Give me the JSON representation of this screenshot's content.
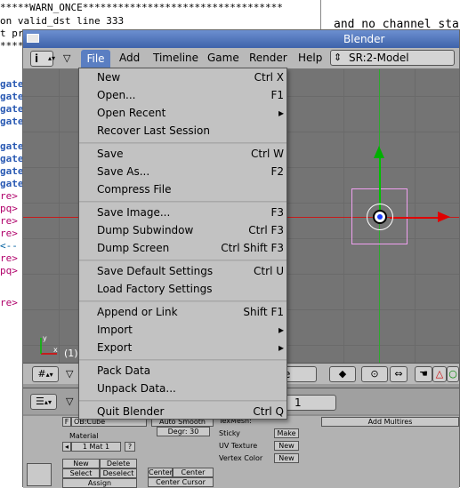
{
  "terminal": {
    "lines": [
      "*****WARN_ONCE**********************************",
      "on valid_dst line 333",
      "t pr",
      "****"
    ],
    "left_fragments": [
      {
        "text": "gate",
        "cls": "gate"
      },
      {
        "text": "gate",
        "cls": "gate"
      },
      {
        "text": "gate",
        "cls": "gate"
      },
      {
        "text": "gate",
        "cls": "gate"
      },
      {
        "text": "gate",
        "cls": "gate"
      },
      {
        "text": "gate",
        "cls": "gate"
      },
      {
        "text": "gate",
        "cls": "gate"
      },
      {
        "text": "gate",
        "cls": "gate"
      },
      {
        "text": "re>",
        "cls": "tag"
      },
      {
        "text": "pq>",
        "cls": "tag"
      },
      {
        "text": "re>",
        "cls": "tag"
      },
      {
        "text": "re>",
        "cls": "tag"
      },
      {
        "text": "<--",
        "cls": "cmt"
      },
      {
        "text": "re>",
        "cls": "tag"
      },
      {
        "text": "pq>",
        "cls": "tag"
      },
      {
        "text": "re>",
        "cls": "tag"
      }
    ],
    "right_text": "and no channel sta"
  },
  "window": {
    "title": "Blender",
    "menus": {
      "file": "File",
      "add": "Add",
      "timeline": "Timeline",
      "game": "Game",
      "render": "Render",
      "help": "Help"
    },
    "info_button": "i",
    "scene": "SR:2-Model",
    "view_number": "(1)",
    "mode_suffix": "e",
    "frame": "1"
  },
  "file_menu": {
    "items": [
      {
        "label": "New",
        "shortcut": "Ctrl X"
      },
      {
        "label": "Open...",
        "shortcut": "F1"
      },
      {
        "label": "Open Recent",
        "shortcut": "▸"
      },
      {
        "label": "Recover Last Session",
        "shortcut": ""
      },
      {
        "label": "Save",
        "shortcut": "Ctrl W"
      },
      {
        "label": "Save As...",
        "shortcut": "F2"
      },
      {
        "label": "Compress File",
        "shortcut": ""
      },
      {
        "label": "Save Image...",
        "shortcut": "F3"
      },
      {
        "label": "Dump Subwindow",
        "shortcut": "Ctrl F3"
      },
      {
        "label": "Dump Screen",
        "shortcut": "Ctrl Shift F3"
      },
      {
        "label": "Save Default Settings",
        "shortcut": "Ctrl U"
      },
      {
        "label": "Load Factory Settings",
        "shortcut": ""
      },
      {
        "label": "Append or Link",
        "shortcut": "Shift F1"
      },
      {
        "label": "Import",
        "shortcut": "▸"
      },
      {
        "label": "Export",
        "shortcut": "▸"
      },
      {
        "label": "Pack Data",
        "shortcut": ""
      },
      {
        "label": "Unpack Data...",
        "shortcut": ""
      },
      {
        "label": "Quit Blender",
        "shortcut": "Ctrl Q"
      }
    ]
  },
  "buttons_panel": {
    "ob_name": "OB:Cube",
    "material_label": "Material",
    "material_slot": "1 Mat 1",
    "material_help": "?",
    "new": "New",
    "delete": "Delete",
    "select": "Select",
    "deselect": "Deselect",
    "assign": "Assign",
    "auto_smooth": "Auto Smooth",
    "degr": "Degr: 30",
    "texmesh": "TexMesh:",
    "sticky": "Sticky",
    "make": "Make",
    "uv_texture": "UV Texture",
    "vertex_color": "Vertex Color",
    "new1": "New",
    "new2": "New",
    "add_multires": "Add Multires",
    "center_new": "Center",
    "center_new2": "Center New",
    "center_cursor": "Center Cursor",
    "f_label": "F"
  },
  "colors": {
    "title_bar": "#4a6fb8",
    "x_axis": "#e00000",
    "y_axis": "#00b000",
    "menu_highlight": "#5a7ec2"
  }
}
